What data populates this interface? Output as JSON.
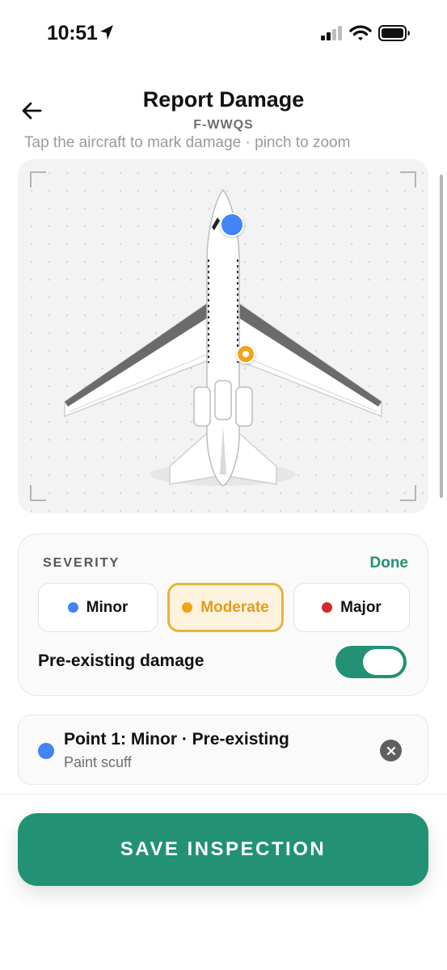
{
  "status_bar": {
    "time": "10:51"
  },
  "header": {
    "title": "Report Damage",
    "subtitle": "F-WWQS",
    "hint": "Tap the aircraft to mark damage · pinch to zoom"
  },
  "severity": {
    "label": "SEVERITY",
    "done_label": "Done",
    "options": [
      {
        "label": "Minor",
        "color": "#4285f4",
        "selected": false
      },
      {
        "label": "Moderate",
        "color": "#f2a31a",
        "selected": true
      },
      {
        "label": "Major",
        "color": "#d62828",
        "selected": false
      }
    ],
    "pre_existing_label": "Pre-existing damage",
    "pre_existing_on": true
  },
  "points": [
    {
      "title": "Point 1: Minor · Pre-existing",
      "description": "Paint scuff",
      "color": "#4285f4"
    }
  ],
  "save_label": "SAVE INSPECTION",
  "colors": {
    "accent": "#229174",
    "moderate": "#f2a31a",
    "minor": "#4285f4",
    "major": "#d62828"
  },
  "icons": {
    "back": "arrow-left-icon",
    "location": "location-arrow-icon",
    "signal": "cellular-signal-icon",
    "wifi": "wifi-icon",
    "battery": "battery-icon",
    "remove": "close-icon"
  }
}
